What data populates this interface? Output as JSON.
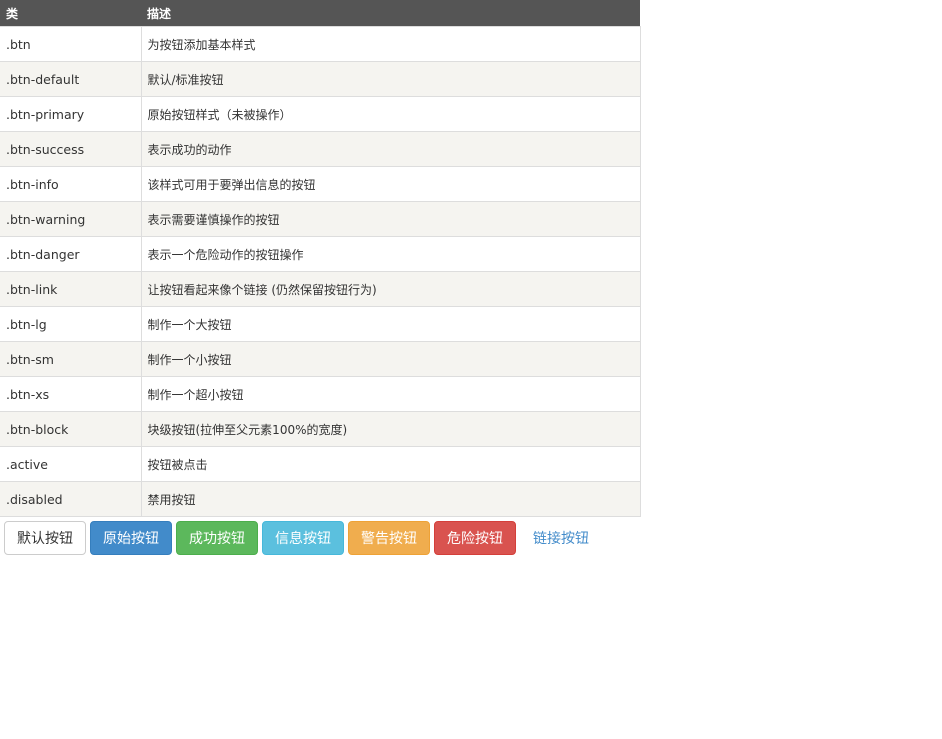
{
  "table": {
    "headers": [
      "类",
      "描述"
    ],
    "rows": [
      {
        "cls": ".btn",
        "desc": "为按钮添加基本样式"
      },
      {
        "cls": ".btn-default",
        "desc": "默认/标准按钮"
      },
      {
        "cls": ".btn-primary",
        "desc": "原始按钮样式（未被操作）"
      },
      {
        "cls": ".btn-success",
        "desc": "表示成功的动作"
      },
      {
        "cls": ".btn-info",
        "desc": "该样式可用于要弹出信息的按钮"
      },
      {
        "cls": ".btn-warning",
        "desc": "表示需要谨慎操作的按钮"
      },
      {
        "cls": ".btn-danger",
        "desc": "表示一个危险动作的按钮操作"
      },
      {
        "cls": ".btn-link",
        "desc": "让按钮看起来像个链接 (仍然保留按钮行为)"
      },
      {
        "cls": ".btn-lg",
        "desc": "制作一个大按钮"
      },
      {
        "cls": ".btn-sm",
        "desc": "制作一个小按钮"
      },
      {
        "cls": ".btn-xs",
        "desc": "制作一个超小按钮"
      },
      {
        "cls": ".btn-block",
        "desc": "块级按钮(拉伸至父元素100%的宽度)"
      },
      {
        "cls": ".active",
        "desc": "按钮被点击"
      },
      {
        "cls": ".disabled",
        "desc": "禁用按钮"
      }
    ]
  },
  "buttons": {
    "default": "默认按钮",
    "primary": "原始按钮",
    "success": "成功按钮",
    "info": "信息按钮",
    "warning": "警告按钮",
    "danger": "危险按钮",
    "link": "链接按钮"
  },
  "colors": {
    "header_bg": "#555555",
    "stripe_bg": "#f5f4f0",
    "primary": "#428bca",
    "success": "#5cb85c",
    "info": "#5bc0de",
    "warning": "#f0ad4e",
    "danger": "#d9534f"
  }
}
